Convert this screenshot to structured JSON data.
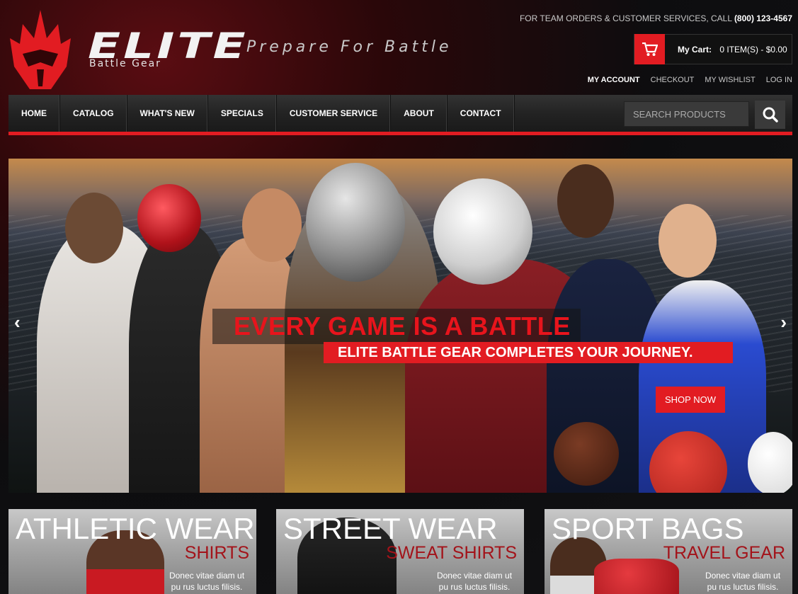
{
  "brand": {
    "name": "ELITE",
    "sub": "Battle Gear",
    "tagline": "Prepare For Battle"
  },
  "header": {
    "phone_prefix": "FOR TEAM ORDERS & CUSTOMER SERVICES, CALL",
    "phone_number": "(800) 123-4567",
    "cart_label": "My Cart:",
    "cart_summary": "0 ITEM(S) - $0.00",
    "account_links": [
      "MY ACCOUNT",
      "CHECKOUT",
      "MY WISHLIST",
      "LOG IN"
    ]
  },
  "nav": {
    "items": [
      "HOME",
      "CATALOG",
      "WHAT'S NEW",
      "SPECIALS",
      "CUSTOMER SERVICE",
      "ABOUT",
      "CONTACT"
    ],
    "search_placeholder": "SEARCH PRODUCTS"
  },
  "hero": {
    "headline": "EVERY GAME IS A BATTLE",
    "subline": "ELITE BATTLE GEAR COMPLETES YOUR JOURNEY.",
    "cta": "SHOP NOW",
    "prev_arrow": "‹",
    "next_arrow": "›"
  },
  "categories": [
    {
      "title": "ATHLETIC WEAR",
      "sub": "SHIRTS",
      "desc": "Donec vitae diam ut pu rus luctus filisis."
    },
    {
      "title": "STREET WEAR",
      "sub": "SWEAT SHIRTS",
      "desc": "Donec vitae diam ut pu rus luctus filisis."
    },
    {
      "title": "SPORT BAGS",
      "sub": "TRAVEL GEAR",
      "desc": "Donec vitae diam ut pu rus luctus filisis."
    }
  ],
  "colors": {
    "accent": "#e21c22",
    "dark": "#111111"
  },
  "icons": {
    "cart": "cart-icon",
    "search": "search-icon",
    "logo": "helmet-logo-icon"
  }
}
